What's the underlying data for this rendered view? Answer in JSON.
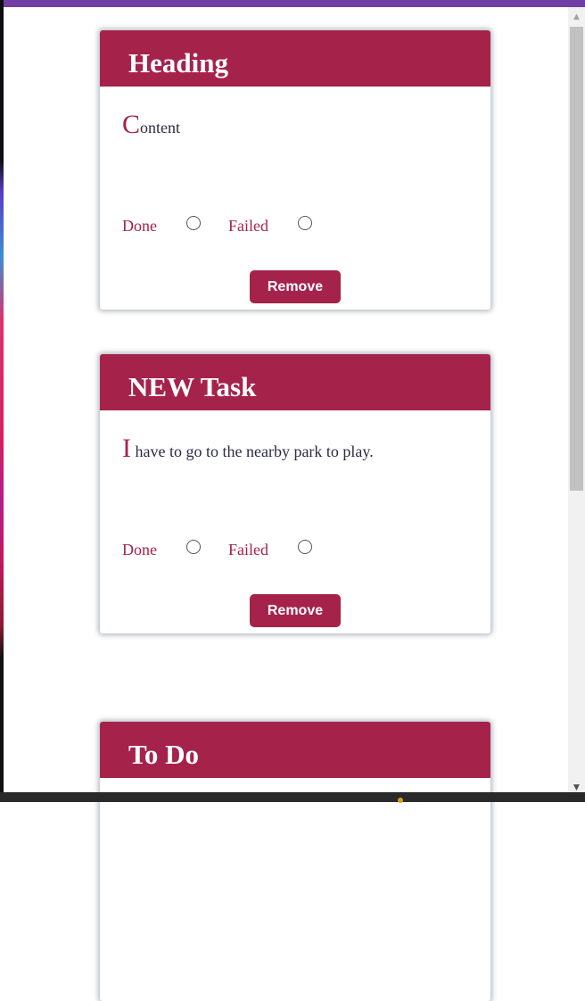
{
  "cards": [
    {
      "title": "Heading",
      "content_first": "C",
      "content_rest": "ontent",
      "done_label": "Done",
      "failed_label": "Failed",
      "remove_label": "Remove"
    },
    {
      "title": "NEW Task",
      "content_first": "I",
      "content_rest": " have to go to the nearby park to play.",
      "done_label": "Done",
      "failed_label": "Failed",
      "remove_label": "Remove"
    },
    {
      "title": "To Do"
    }
  ],
  "colors": {
    "accent": "#a5234a",
    "top_bar": "#6f3fa6",
    "text": "#2b2b44"
  },
  "scrollbar": {
    "up_icon": "scroll-up-arrow-icon",
    "down_icon": "scroll-down-arrow-icon"
  }
}
